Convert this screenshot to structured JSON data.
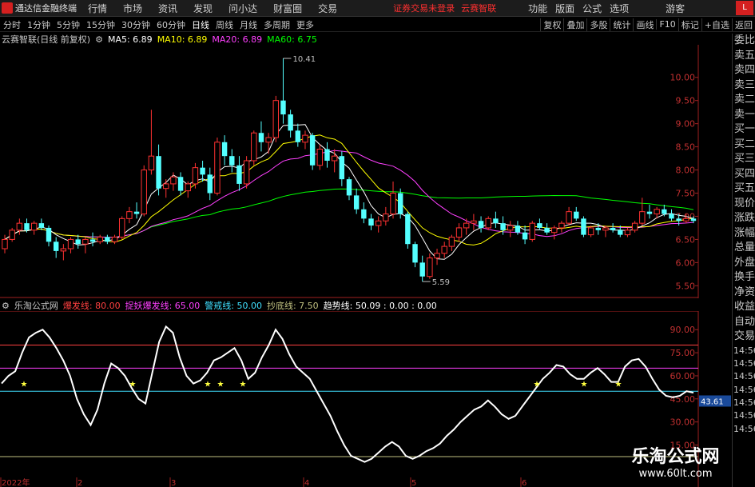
{
  "topbar": {
    "app_title": "通达信金融终端",
    "menus": [
      "行情",
      "市场",
      "资讯",
      "发现",
      "问小达",
      "财富圈",
      "交易"
    ],
    "warning": "证券交易未登录",
    "stock_name": "云赛智联",
    "right_menus": [
      "功能",
      "版面",
      "公式",
      "选项"
    ],
    "guest": "游客",
    "level": "L"
  },
  "periodbar": {
    "periods": [
      "分时",
      "1分钟",
      "5分钟",
      "15分钟",
      "30分钟",
      "60分钟",
      "日线",
      "周线",
      "月线",
      "多周期",
      "更多"
    ],
    "active": "日线",
    "right_items": [
      "复权",
      "叠加",
      "多股",
      "统计",
      "画线",
      "F10",
      "标记",
      "+自选",
      "返回"
    ]
  },
  "main_legend": {
    "title": "云赛智联(日线 前复权)",
    "ma5": "MA5: 6.89",
    "ma10": "MA10: 6.89",
    "ma20": "MA20: 6.89",
    "ma60": "MA60: 6.75",
    "colors": {
      "ma5": "#ffffff",
      "ma10": "#ffff00",
      "ma20": "#ff40ff",
      "ma60": "#00ff00"
    }
  },
  "osc_legend": {
    "title": "乐淘公式网",
    "l1": "爆发线: 80.00",
    "l2": "捉妖爆发线: 65.00",
    "l3": "警戒线: 50.00",
    "l4": "抄底线: 7.50",
    "l5": "趋势线: 50.09 : 0.00 : 0.00",
    "colors": {
      "l1": "#ff4040",
      "l2": "#ff40ff",
      "l3": "#40e0ff",
      "l4": "#c0c080",
      "l5": "#ffffff"
    }
  },
  "chart_data": [
    {
      "type": "candlestick",
      "title": "云赛智联(日线 前复权)",
      "y_ticks": [
        5.5,
        6.0,
        6.5,
        7.0,
        7.5,
        8.0,
        8.5,
        9.0,
        9.5,
        10.0
      ],
      "ylim": [
        5.35,
        10.6
      ],
      "high_label": "10.41",
      "low_label": "5.59",
      "x_month_labels": [
        "2022年",
        "2",
        "3",
        "4",
        "5",
        "6"
      ],
      "candles": [
        [
          6.3,
          6.6,
          6.2,
          6.5
        ],
        [
          6.5,
          6.75,
          6.45,
          6.7
        ],
        [
          6.7,
          6.95,
          6.6,
          6.85
        ],
        [
          6.85,
          6.95,
          6.65,
          6.7
        ],
        [
          6.7,
          6.9,
          6.6,
          6.85
        ],
        [
          6.85,
          6.95,
          6.7,
          6.75
        ],
        [
          6.75,
          6.8,
          6.35,
          6.45
        ],
        [
          6.45,
          6.55,
          6.1,
          6.25
        ],
        [
          6.25,
          6.4,
          6.05,
          6.3
        ],
        [
          6.3,
          6.55,
          6.2,
          6.5
        ],
        [
          6.5,
          6.6,
          6.3,
          6.4
        ],
        [
          6.4,
          6.55,
          6.2,
          6.5
        ],
        [
          6.5,
          6.65,
          6.35,
          6.45
        ],
        [
          6.45,
          6.6,
          6.4,
          6.55
        ],
        [
          6.55,
          6.6,
          6.4,
          6.45
        ],
        [
          6.45,
          6.6,
          6.4,
          6.55
        ],
        [
          6.55,
          7.0,
          6.5,
          6.95
        ],
        [
          6.95,
          7.2,
          6.85,
          7.1
        ],
        [
          7.1,
          7.3,
          6.95,
          7.05
        ],
        [
          7.05,
          8.1,
          7.0,
          8.0
        ],
        [
          8.0,
          9.3,
          7.9,
          8.3
        ],
        [
          8.3,
          8.55,
          7.45,
          7.6
        ],
        [
          7.6,
          7.8,
          7.4,
          7.7
        ],
        [
          7.7,
          7.95,
          7.55,
          7.85
        ],
        [
          7.85,
          7.95,
          7.45,
          7.55
        ],
        [
          7.55,
          7.75,
          7.4,
          7.7
        ],
        [
          7.7,
          8.15,
          7.6,
          8.05
        ],
        [
          8.05,
          8.2,
          7.75,
          7.9
        ],
        [
          7.9,
          8.05,
          7.35,
          7.5
        ],
        [
          7.5,
          8.7,
          7.45,
          8.6
        ],
        [
          8.6,
          8.75,
          8.1,
          8.3
        ],
        [
          8.3,
          8.45,
          7.95,
          8.1
        ],
        [
          8.1,
          8.3,
          7.55,
          7.7
        ],
        [
          7.7,
          8.3,
          7.6,
          8.2
        ],
        [
          8.2,
          8.85,
          8.1,
          8.8
        ],
        [
          8.8,
          9.05,
          8.4,
          8.6
        ],
        [
          8.6,
          8.8,
          8.35,
          8.7
        ],
        [
          8.7,
          9.6,
          8.6,
          9.5
        ],
        [
          9.5,
          10.41,
          9.0,
          9.2
        ],
        [
          9.2,
          9.3,
          8.7,
          8.85
        ],
        [
          8.85,
          9.0,
          8.5,
          8.6
        ],
        [
          8.6,
          8.85,
          8.45,
          8.75
        ],
        [
          8.75,
          8.8,
          8.0,
          8.1
        ],
        [
          8.1,
          8.55,
          8.0,
          8.45
        ],
        [
          8.45,
          8.6,
          8.05,
          8.2
        ],
        [
          8.2,
          8.45,
          7.95,
          8.3
        ],
        [
          8.3,
          8.4,
          7.65,
          7.8
        ],
        [
          7.8,
          7.85,
          7.35,
          7.45
        ],
        [
          7.45,
          7.6,
          7.05,
          7.15
        ],
        [
          7.15,
          7.3,
          6.85,
          6.95
        ],
        [
          6.95,
          7.05,
          6.7,
          6.8
        ],
        [
          6.8,
          7.0,
          6.65,
          6.9
        ],
        [
          6.9,
          7.2,
          6.8,
          7.05
        ],
        [
          7.05,
          7.75,
          6.95,
          7.5
        ],
        [
          7.5,
          7.6,
          6.95,
          7.05
        ],
        [
          7.05,
          7.1,
          6.3,
          6.4
        ],
        [
          6.4,
          6.45,
          5.9,
          6.0
        ],
        [
          6.0,
          6.15,
          5.59,
          5.7
        ],
        [
          5.7,
          6.2,
          5.65,
          6.1
        ],
        [
          6.1,
          6.3,
          5.95,
          6.2
        ],
        [
          6.2,
          6.45,
          6.1,
          6.35
        ],
        [
          6.35,
          6.6,
          6.25,
          6.55
        ],
        [
          6.55,
          6.85,
          6.45,
          6.75
        ],
        [
          6.75,
          6.95,
          6.6,
          6.85
        ],
        [
          6.85,
          7.05,
          6.7,
          6.9
        ],
        [
          6.9,
          7.0,
          6.65,
          6.75
        ],
        [
          6.75,
          7.0,
          6.7,
          6.95
        ],
        [
          6.95,
          7.1,
          6.75,
          6.85
        ],
        [
          6.85,
          7.0,
          6.6,
          6.7
        ],
        [
          6.7,
          6.9,
          6.55,
          6.8
        ],
        [
          6.8,
          6.9,
          6.6,
          6.65
        ],
        [
          6.65,
          6.8,
          6.4,
          6.5
        ],
        [
          6.5,
          6.9,
          6.45,
          6.85
        ],
        [
          6.85,
          6.95,
          6.7,
          6.75
        ],
        [
          6.75,
          6.85,
          6.6,
          6.65
        ],
        [
          6.65,
          6.8,
          6.5,
          6.75
        ],
        [
          6.75,
          6.9,
          6.65,
          6.85
        ],
        [
          6.85,
          7.2,
          6.8,
          7.1
        ],
        [
          7.1,
          7.2,
          6.9,
          6.95
        ],
        [
          6.95,
          7.0,
          6.55,
          6.6
        ],
        [
          6.6,
          6.8,
          6.55,
          6.75
        ],
        [
          6.75,
          6.85,
          6.6,
          6.7
        ],
        [
          6.7,
          6.8,
          6.55,
          6.75
        ],
        [
          6.75,
          6.85,
          6.65,
          6.7
        ],
        [
          6.7,
          6.8,
          6.55,
          6.6
        ],
        [
          6.6,
          6.75,
          6.55,
          6.7
        ],
        [
          6.7,
          6.9,
          6.65,
          6.85
        ],
        [
          6.85,
          7.4,
          6.8,
          7.1
        ],
        [
          7.1,
          7.25,
          6.95,
          7.05
        ],
        [
          7.05,
          7.2,
          6.95,
          7.15
        ],
        [
          7.15,
          7.25,
          7.0,
          7.05
        ],
        [
          7.05,
          7.15,
          6.9,
          6.95
        ],
        [
          6.95,
          7.05,
          6.8,
          6.9
        ],
        [
          6.9,
          7.05,
          6.85,
          6.95
        ],
        [
          6.95,
          7.0,
          6.85,
          6.9
        ]
      ]
    },
    {
      "type": "line",
      "title": "乐淘公式网",
      "y_ticks": [
        15.0,
        30.0,
        45.0,
        60.0,
        75.0,
        90.0
      ],
      "ylim": [
        -5,
        100
      ],
      "last_value_label": "43.61",
      "reference_lines": [
        80,
        65,
        50,
        7.5
      ],
      "series": [
        {
          "name": "趋势线",
          "values": [
            55,
            60,
            63,
            75,
            85,
            88,
            90,
            85,
            78,
            70,
            60,
            45,
            35,
            28,
            38,
            55,
            68,
            65,
            60,
            52,
            45,
            42,
            62,
            82,
            92,
            88,
            72,
            60,
            55,
            57,
            62,
            70,
            72,
            75,
            78,
            70,
            58,
            62,
            72,
            80,
            90,
            84,
            74,
            66,
            62,
            58,
            50,
            42,
            34,
            24,
            15,
            8,
            6,
            4,
            6,
            10,
            14,
            17,
            14,
            8,
            6,
            8,
            11,
            13,
            16,
            21,
            25,
            30,
            34,
            38,
            40,
            44,
            40,
            35,
            32,
            34,
            40,
            46,
            52,
            58,
            62,
            67,
            66,
            61,
            58,
            58,
            62,
            65,
            61,
            56,
            56,
            66,
            70,
            71,
            66,
            58,
            51,
            47,
            46,
            47,
            50,
            49
          ]
        },
        {
          "name": "star_markers",
          "values": [
            7,
            34,
            57,
            61,
            65,
            147,
            160,
            172,
            184
          ]
        }
      ]
    }
  ],
  "right_panel": {
    "items": [
      "委比",
      "卖五",
      "卖四",
      "卖三",
      "卖二",
      "卖一",
      "买一",
      "买二",
      "买三",
      "买四",
      "买五",
      "现价",
      "涨跌",
      "涨幅",
      "总量",
      "外盘",
      "换手",
      "净资",
      "收益",
      "自动",
      "交易"
    ],
    "times": [
      "14:56",
      "14:56",
      "14:56",
      "14:56",
      "14:56",
      "14:56",
      "14:56"
    ]
  },
  "watermark": {
    "line1": "乐淘公式网",
    "line2": "www.60lt.com"
  }
}
